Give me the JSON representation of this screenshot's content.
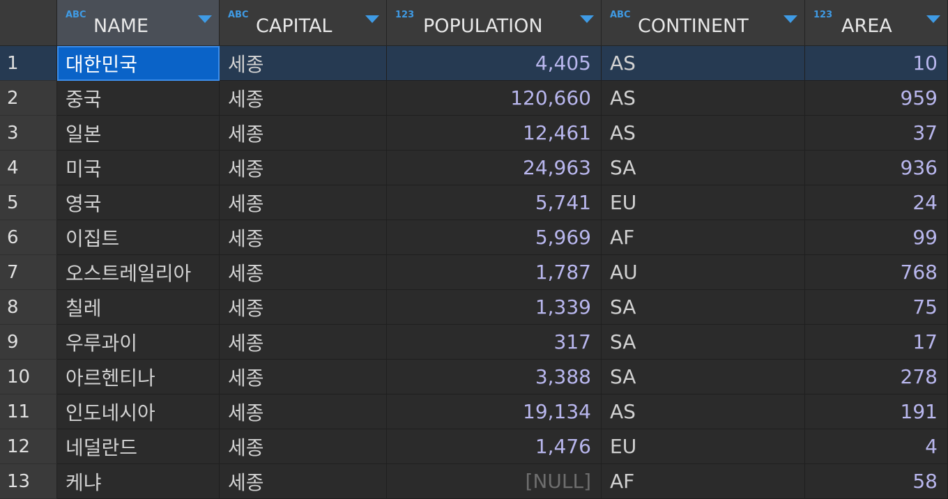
{
  "columns": [
    {
      "type": "ABC",
      "label": "NAME"
    },
    {
      "type": "ABC",
      "label": "CAPITAL"
    },
    {
      "type": "123",
      "label": "POPULATION"
    },
    {
      "type": "ABC",
      "label": "CONTINENT"
    },
    {
      "type": "123",
      "label": "AREA"
    }
  ],
  "rows": [
    {
      "n": "1",
      "name": "대한민국",
      "capital": "세종",
      "population": "4,405",
      "continent": "AS",
      "area": "10"
    },
    {
      "n": "2",
      "name": "중국",
      "capital": "세종",
      "population": "120,660",
      "continent": "AS",
      "area": "959"
    },
    {
      "n": "3",
      "name": "일본",
      "capital": "세종",
      "population": "12,461",
      "continent": "AS",
      "area": "37"
    },
    {
      "n": "4",
      "name": "미국",
      "capital": "세종",
      "population": "24,963",
      "continent": "SA",
      "area": "936"
    },
    {
      "n": "5",
      "name": "영국",
      "capital": "세종",
      "population": "5,741",
      "continent": "EU",
      "area": "24"
    },
    {
      "n": "6",
      "name": "이집트",
      "capital": "세종",
      "population": "5,969",
      "continent": "AF",
      "area": "99"
    },
    {
      "n": "7",
      "name": "오스트레일리아",
      "capital": "세종",
      "population": "1,787",
      "continent": "AU",
      "area": "768"
    },
    {
      "n": "8",
      "name": "칠레",
      "capital": "세종",
      "population": "1,339",
      "continent": "SA",
      "area": "75"
    },
    {
      "n": "9",
      "name": "우루과이",
      "capital": "세종",
      "population": "317",
      "continent": "SA",
      "area": "17"
    },
    {
      "n": "10",
      "name": "아르헨티나",
      "capital": "세종",
      "population": "3,388",
      "continent": "SA",
      "area": "278"
    },
    {
      "n": "11",
      "name": "인도네시아",
      "capital": "세종",
      "population": "19,134",
      "continent": "AS",
      "area": "191"
    },
    {
      "n": "12",
      "name": "네덜란드",
      "capital": "세종",
      "population": "1,476",
      "continent": "EU",
      "area": "4"
    },
    {
      "n": "13",
      "name": "케냐",
      "capital": "세종",
      "population": "[NULL]",
      "continent": "AF",
      "area": "58"
    }
  ],
  "null_text": "[NULL]",
  "colors": {
    "selected_cell": "#0a63c8",
    "selected_row": "#263a52",
    "type_icon": "#3f9be5",
    "number_text": "#b9b7ee"
  }
}
